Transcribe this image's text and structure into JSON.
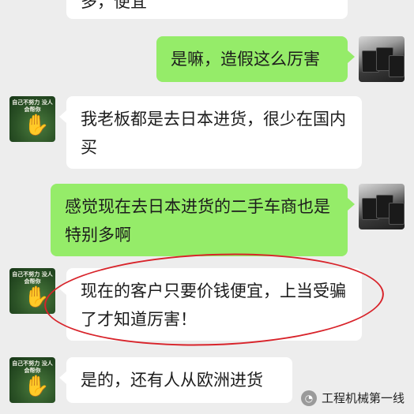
{
  "chat": {
    "messages": [
      {
        "side": "left",
        "text": "多，便宜"
      },
      {
        "side": "right",
        "text": "是嘛，造假这么厉害"
      },
      {
        "side": "left",
        "text": "我老板都是去日本进货，很少在国内买"
      },
      {
        "side": "right",
        "text": "感觉现在去日本进货的二手车商也是特别多啊"
      },
      {
        "side": "left",
        "text": "现在的客户只要价钱便宜，上当受骗了才知道厉害！"
      },
      {
        "side": "left",
        "text": "是的，还有人从欧洲进货"
      }
    ],
    "avatar_caption": "自己不努力 没人会帮你"
  },
  "watermark": {
    "text": "工程机械第一线",
    "icon": "wechat-icon"
  },
  "colors": {
    "background": "#ededed",
    "bubble_sent": "#95ec69",
    "bubble_received": "#ffffff",
    "highlight_ring": "#d8232a"
  }
}
